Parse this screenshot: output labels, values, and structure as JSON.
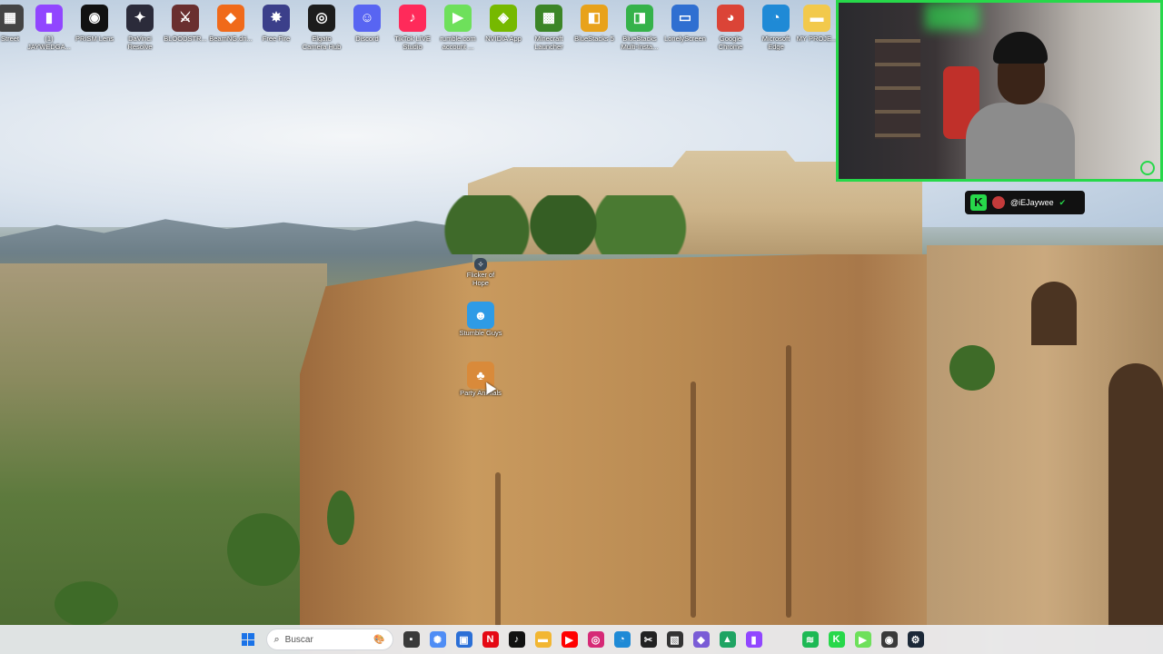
{
  "desktop_icons": [
    {
      "label": "Street",
      "icon": "app-icon",
      "color": "#444444",
      "glyph": "▦"
    },
    {
      "label": "(1) JAYWEDGA...",
      "icon": "twitch-icon",
      "color": "#9146ff",
      "glyph": "▮"
    },
    {
      "label": "PRISM Lens",
      "icon": "camera-lens-icon",
      "color": "#111111",
      "glyph": "◉"
    },
    {
      "label": "DaVinci Resolve",
      "icon": "davinci-resolve-icon",
      "color": "#2b2b3a",
      "glyph": "✦"
    },
    {
      "label": "BLOODSTR...",
      "icon": "game-icon",
      "color": "#6a2f2f",
      "glyph": "⚔"
    },
    {
      "label": "BeamNG.dri...",
      "icon": "beamng-icon",
      "color": "#f06a1a",
      "glyph": "◆"
    },
    {
      "label": "Free Fire",
      "icon": "free-fire-icon",
      "color": "#3b3f8a",
      "glyph": "✸"
    },
    {
      "label": "Elgato Camera Hub",
      "icon": "elgato-camera-icon",
      "color": "#1c1c1c",
      "glyph": "◎"
    },
    {
      "label": "Discord",
      "icon": "discord-icon",
      "color": "#5865f2",
      "glyph": "☺"
    },
    {
      "label": "TikTok LIVE Studio",
      "icon": "tiktok-icon",
      "color": "#ff2a5a",
      "glyph": "♪"
    },
    {
      "label": "rumble.com account ...",
      "icon": "rumble-icon",
      "color": "#6ee05b",
      "glyph": "▶"
    },
    {
      "label": "NVIDIA App",
      "icon": "nvidia-icon",
      "color": "#76b900",
      "glyph": "◈"
    },
    {
      "label": "Minecraft Launcher",
      "icon": "minecraft-icon",
      "color": "#3c8527",
      "glyph": "▩"
    },
    {
      "label": "BlueStacks 5",
      "icon": "bluestacks-icon",
      "color": "#e8a21b",
      "glyph": "◧"
    },
    {
      "label": "BlueStacks Multi-Insta...",
      "icon": "bluestacks-multi-icon",
      "color": "#35b24a",
      "glyph": "◨"
    },
    {
      "label": "LonelyScreen",
      "icon": "monitor-icon",
      "color": "#2f6fd1",
      "glyph": "▭"
    },
    {
      "label": "Google Chrome",
      "icon": "chrome-icon",
      "color": "#db4437",
      "glyph": "◕"
    },
    {
      "label": "Microsoft Edge",
      "icon": "edge-icon",
      "color": "#1f8ad6",
      "glyph": "◔"
    },
    {
      "label": "MY PROJE...",
      "icon": "folder-icon",
      "color": "#f2c94c",
      "glyph": "▬"
    }
  ],
  "vertical_icons": [
    {
      "label": "Flicker of Hope",
      "icon": "game-icon",
      "color": "#3a4a5a",
      "glyph": "✧"
    },
    {
      "label": "Stumble Guys",
      "icon": "stumble-guys-icon",
      "color": "#2e9be6",
      "glyph": "☻"
    },
    {
      "label": "Party Animals",
      "icon": "party-animals-icon",
      "color": "#d98a3a",
      "glyph": "♣"
    }
  ],
  "overlay": {
    "handle": "@iEJaywee",
    "kick_letter": "K",
    "accent": "#27d84a"
  },
  "taskbar": {
    "search_placeholder": "Buscar",
    "apps": [
      {
        "icon": "file-explorer-icon",
        "color": "#3a3a3a",
        "glyph": "▪"
      },
      {
        "icon": "copilot-icon",
        "color": "#4f8df5",
        "glyph": "✺"
      },
      {
        "icon": "store-icon",
        "color": "#2b6fd6",
        "glyph": "▣"
      },
      {
        "icon": "netflix-icon",
        "color": "#e50914",
        "glyph": "N"
      },
      {
        "icon": "tiktok-icon",
        "color": "#111111",
        "glyph": "♪"
      },
      {
        "icon": "folder-icon",
        "color": "#f2b632",
        "glyph": "▬"
      },
      {
        "icon": "youtube-icon",
        "color": "#ff0000",
        "glyph": "▶"
      },
      {
        "icon": "instagram-icon",
        "color": "#d62976",
        "glyph": "◎"
      },
      {
        "icon": "edge-icon",
        "color": "#1f8ad6",
        "glyph": "◔"
      },
      {
        "icon": "capcut-icon",
        "color": "#222222",
        "glyph": "✂"
      },
      {
        "icon": "capture-icon",
        "color": "#333333",
        "glyph": "▧"
      },
      {
        "icon": "app-icon",
        "color": "#7a5cd6",
        "glyph": "◆"
      },
      {
        "icon": "drive-icon",
        "color": "#1fa463",
        "glyph": "▲"
      },
      {
        "icon": "twitch-icon",
        "color": "#9146ff",
        "glyph": "▮"
      },
      {
        "icon": "spotify-icon",
        "color": "#1db954",
        "glyph": "≋"
      },
      {
        "icon": "kick-icon",
        "color": "#27d84a",
        "glyph": "K"
      },
      {
        "icon": "rumble-icon",
        "color": "#6ee05b",
        "glyph": "▶"
      },
      {
        "icon": "obs-icon",
        "color": "#3a3a3a",
        "glyph": "◉"
      },
      {
        "icon": "steam-icon",
        "color": "#1b2838",
        "glyph": "⚙"
      }
    ]
  }
}
